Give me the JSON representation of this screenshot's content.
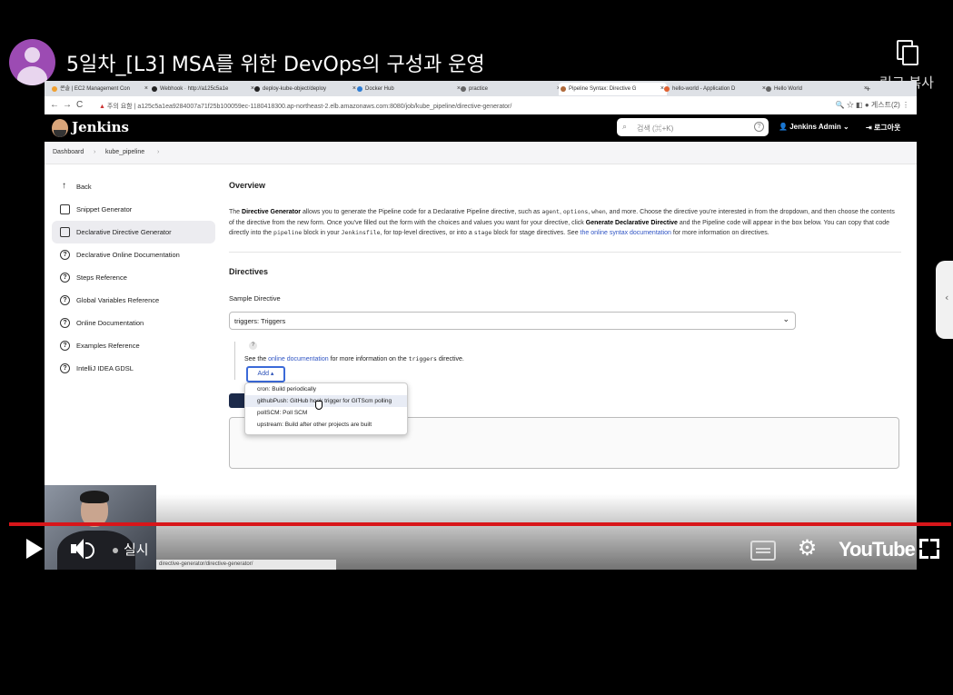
{
  "youtube": {
    "title": "5일차_[L3] MSA를 위한 DevOps의 구성과 운영",
    "copy_link_label": "링크 복사",
    "live_label": "실시",
    "logo_text": "YouTube"
  },
  "browser": {
    "tabs": [
      {
        "label": "콘솔 | EC2 Management Con"
      },
      {
        "label": "Webhook · http://a125c5a1e"
      },
      {
        "label": "deploy-kube-object/deploy"
      },
      {
        "label": "Docker Hub"
      },
      {
        "label": "practice"
      },
      {
        "label": "Pipeline Syntax: Directive G"
      },
      {
        "label": "hello-world - Application D"
      },
      {
        "label": "Hello World"
      }
    ],
    "security_label": "주의 요함",
    "url": "a125c5a1ea9284007a71f25b100059ec-1180418300.ap-northeast-2.elb.amazonaws.com:8080/job/kube_pipeline/directive-generator/",
    "profile_label": "게스트(2)"
  },
  "jenkins": {
    "brand": "Jenkins",
    "search_placeholder": "검색 (⌘+K)",
    "user": "Jenkins Admin",
    "logout": "로그아웃",
    "breadcrumb": [
      "Dashboard",
      "kube_pipeline"
    ],
    "sidebar": [
      {
        "label": "Back",
        "icon": "arrow-up-icon"
      },
      {
        "label": "Snippet Generator",
        "icon": "gear-icon"
      },
      {
        "label": "Declarative Directive Generator",
        "icon": "gear-icon"
      },
      {
        "label": "Declarative Online Documentation",
        "icon": "help-icon"
      },
      {
        "label": "Steps Reference",
        "icon": "help-icon"
      },
      {
        "label": "Global Variables Reference",
        "icon": "help-icon"
      },
      {
        "label": "Online Documentation",
        "icon": "help-icon"
      },
      {
        "label": "Examples Reference",
        "icon": "help-icon"
      },
      {
        "label": "IntelliJ IDEA GDSL",
        "icon": "help-icon"
      }
    ],
    "overview_heading": "Overview",
    "overview": {
      "p1": "The ",
      "b1": "Directive Generator",
      "p2": " allows you to generate the Pipeline code for a Declarative Pipeline directive, such as ",
      "c1": "agent",
      "p3": ", ",
      "c2": "options",
      "p4": ", ",
      "c3": "when",
      "p5": ", and more. Choose the directive you're interested in from the dropdown, and then choose the contents of the directive from the new form. Once you've filled out the form with the choices and values you want for your directive, click ",
      "b2": "Generate Declarative Directive",
      "p6": " and the Pipeline code will appear in the box below. You can copy that code directly into the ",
      "c4": "pipeline",
      "p7": " block in your ",
      "c5": "Jenkinsfile",
      "p8": ", for top-level directives, or into a ",
      "c6": "stage",
      "p9": " block for stage directives. See ",
      "link": "the online syntax documentation",
      "p10": " for more information on directives."
    },
    "directives_heading": "Directives",
    "sample_label": "Sample Directive",
    "sample_value": "triggers: Triggers",
    "see_prefix": "See the ",
    "see_link": "online documentation",
    "see_mid": " for more information on the ",
    "see_code": "triggers",
    "see_suffix": " directive.",
    "add_label": "Add ▴",
    "menu": [
      "cron: Build periodically",
      "githubPush: GitHub hook trigger for GITScm polling",
      "pollSCM: Poll SCM",
      "upstream: Build after other projects are built"
    ],
    "status_url": "directive-generator/directive-generator/"
  },
  "colors": {
    "progress": "#d8161a",
    "jenkins_header": "#000000",
    "link": "#3055c4"
  }
}
